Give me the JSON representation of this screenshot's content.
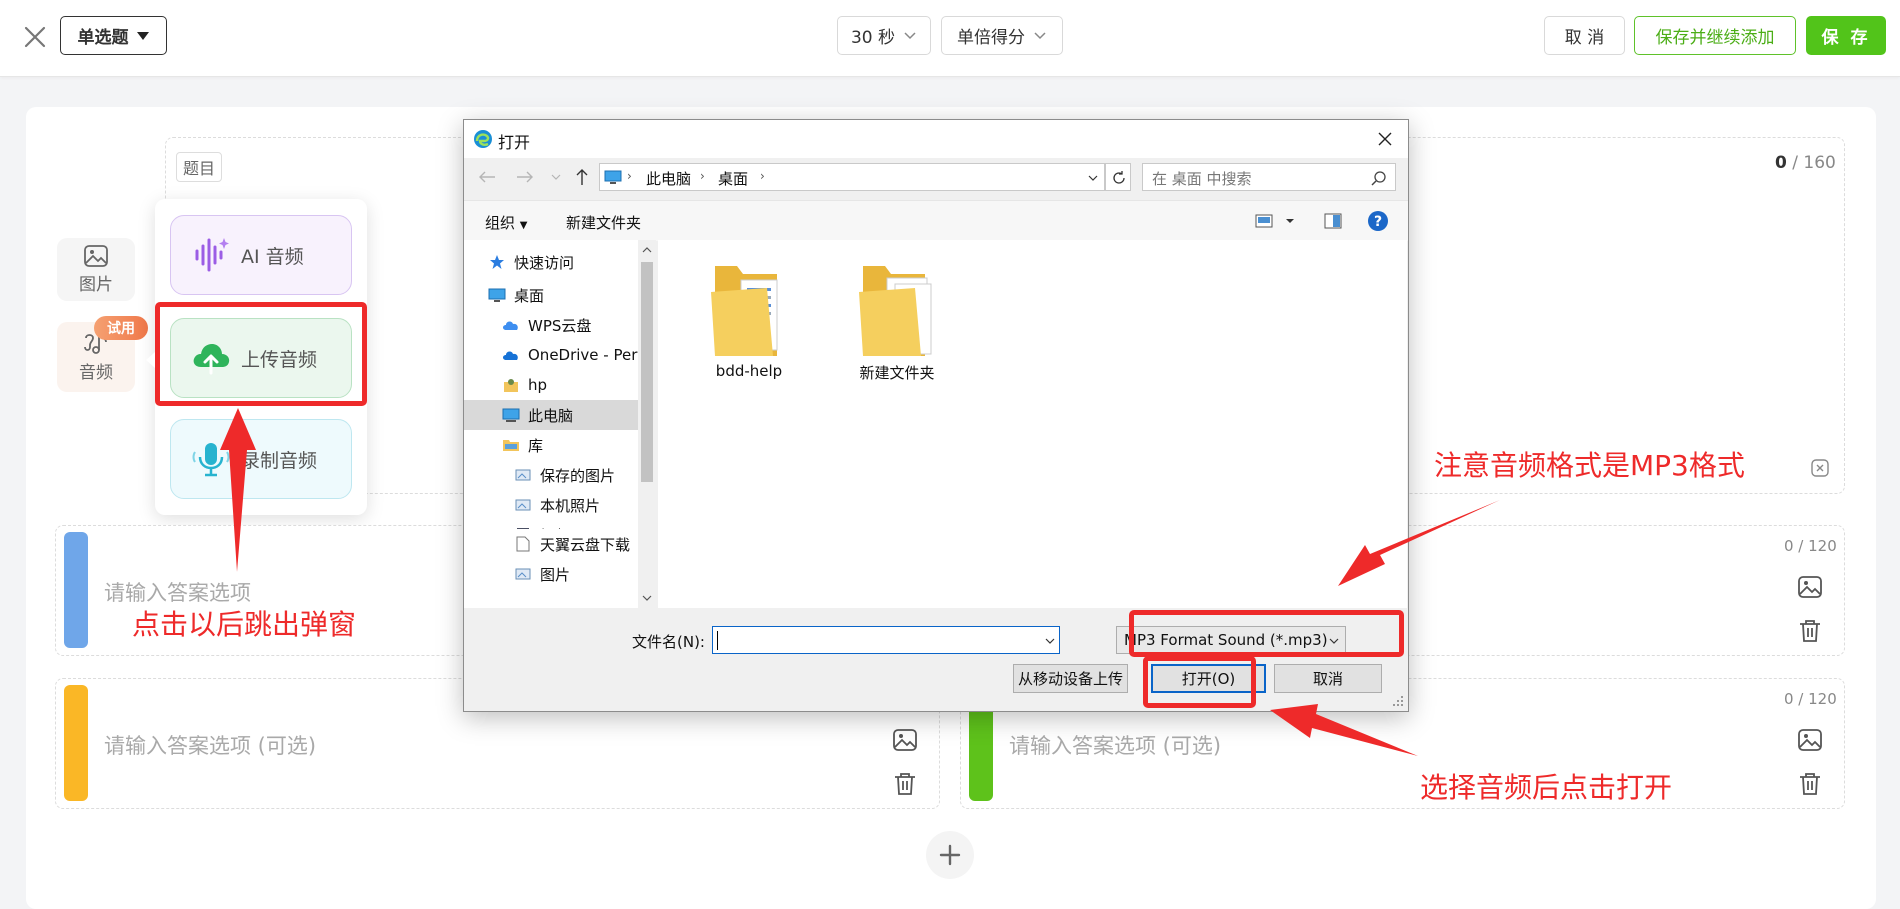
{
  "topbar": {
    "question_type": "单选题",
    "time": "30 秒",
    "score_mode": "单倍得分",
    "cancel": "取 消",
    "save_continue": "保存并继续添加",
    "save": "保 存"
  },
  "editor": {
    "question_tag": "题目",
    "question_count_num": "0",
    "question_count_max": "/ 160",
    "option_placeholder": "请输入答案选项",
    "option_placeholder_optional": "请输入答案选项 (可选)",
    "option_count": "0 / 120"
  },
  "tools": {
    "image_label": "图片",
    "audio_label": "音频",
    "trial_badge": "试用"
  },
  "popover": {
    "ai_audio": "AI 音频",
    "upload_audio": "上传音频",
    "record_audio": "录制音频"
  },
  "dialog": {
    "title": "打开",
    "breadcrumb": [
      "此电脑",
      "桌面"
    ],
    "search_placeholder": "在 桌面 中搜索",
    "organize": "组织",
    "new_folder": "新建文件夹",
    "tree": [
      "快速访问",
      "桌面",
      "WPS云盘",
      "OneDrive - Pers",
      "hp",
      "此电脑",
      "库",
      "保存的图片",
      "本机照片",
      "视频",
      "天翼云盘下载",
      "图片"
    ],
    "files": [
      "bdd-help",
      "新建文件夹"
    ],
    "filename_label": "文件名(N):",
    "filetype": "MP3 Format Sound (*.mp3)",
    "from_device": "从移动设备上传",
    "open": "打开(O)",
    "cancel": "取消"
  },
  "annotations": {
    "popup": "点击以后跳出弹窗",
    "format": "注意音频格式是MP3格式",
    "open_after": "选择音频后点击打开"
  },
  "colors": {
    "accent": "#52c41a",
    "annotation": "#ee2a2a",
    "option_a": "#6fa6e9",
    "option_b": "#fab726",
    "option_c": "#5ec21b"
  }
}
